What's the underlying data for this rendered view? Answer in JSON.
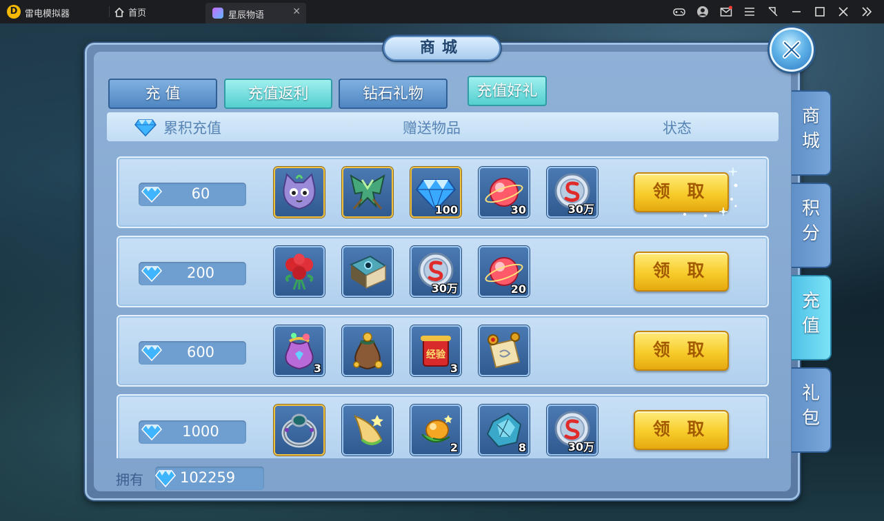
{
  "emulator": {
    "app_name": "雷电模拟器",
    "home_label": "首页",
    "tab_label": "星辰物语",
    "tab_close": "✕"
  },
  "shop": {
    "title": "商城",
    "tabs": [
      {
        "label": "充 值",
        "active": false
      },
      {
        "label": "充值返利",
        "active": true
      },
      {
        "label": "钻石礼物",
        "active": false
      },
      {
        "label": "充值好礼",
        "active": true
      }
    ],
    "columns": {
      "amount": "累积充值",
      "items": "赠送物品",
      "status": "状态"
    },
    "rows": [
      {
        "amount": "60",
        "claim_label": "领 取",
        "items": [
          {
            "icon": "purple-cat-icon",
            "qty": "",
            "frame": "gold"
          },
          {
            "icon": "green-wings-icon",
            "qty": "",
            "frame": "gold"
          },
          {
            "icon": "diamond-icon",
            "qty": "100",
            "frame": "gold"
          },
          {
            "icon": "red-orb-icon",
            "qty": "30",
            "frame": "blue"
          },
          {
            "icon": "silver-coin-icon",
            "qty": "30万",
            "frame": "blue"
          }
        ]
      },
      {
        "amount": "200",
        "claim_label": "领 取",
        "items": [
          {
            "icon": "rose-bouquet-icon",
            "qty": "",
            "frame": "blue"
          },
          {
            "icon": "spellbook-icon",
            "qty": "",
            "frame": "blue"
          },
          {
            "icon": "silver-coin-icon",
            "qty": "30万",
            "frame": "blue"
          },
          {
            "icon": "red-orb-icon",
            "qty": "20",
            "frame": "blue"
          }
        ]
      },
      {
        "amount": "600",
        "claim_label": "领 取",
        "items": [
          {
            "icon": "gem-pouch-icon",
            "qty": "3",
            "frame": "blue"
          },
          {
            "icon": "money-bag-icon",
            "qty": "",
            "frame": "blue"
          },
          {
            "icon": "exp-scroll-icon",
            "qty": "3",
            "frame": "blue",
            "text": "经验"
          },
          {
            "icon": "treasure-scroll-icon",
            "qty": "",
            "frame": "blue"
          }
        ]
      },
      {
        "amount": "1000",
        "claim_label": "领 取",
        "items": [
          {
            "icon": "ring-icon",
            "qty": "",
            "frame": "gold"
          },
          {
            "icon": "horn-icon",
            "qty": "",
            "frame": "blue"
          },
          {
            "icon": "golden-fruit-icon",
            "qty": "2",
            "frame": "blue"
          },
          {
            "icon": "crystal-ore-icon",
            "qty": "8",
            "frame": "blue"
          },
          {
            "icon": "silver-coin-icon",
            "qty": "30万",
            "frame": "blue"
          }
        ]
      }
    ],
    "footer": {
      "label": "拥有",
      "balance": "102259"
    },
    "side_tabs": [
      {
        "label": "商城",
        "active": false
      },
      {
        "label": "积分",
        "active": false
      },
      {
        "label": "充值",
        "active": true
      },
      {
        "label": "礼包",
        "active": false
      }
    ]
  },
  "colors": {
    "panel": "#7fa3cc",
    "active_tab": "#54cfd0",
    "claim_button": "#f7cc2a"
  }
}
